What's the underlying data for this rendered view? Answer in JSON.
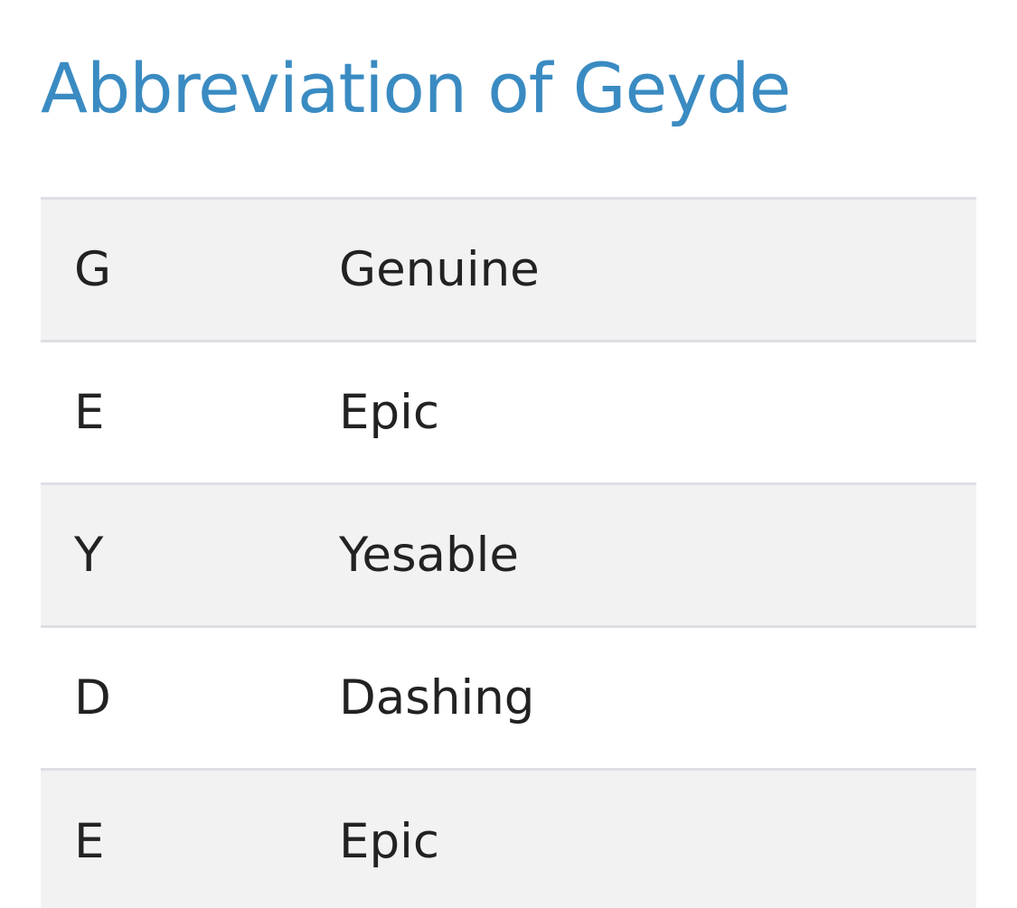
{
  "title": "Abbreviation of Geyde",
  "rows": [
    {
      "letter": "G",
      "word": "Genuine"
    },
    {
      "letter": "E",
      "word": "Epic"
    },
    {
      "letter": "Y",
      "word": "Yesable"
    },
    {
      "letter": "D",
      "word": "Dashing"
    },
    {
      "letter": "E",
      "word": "Epic"
    }
  ],
  "colors": {
    "title": "#3a8bc2",
    "row_shaded": "#f2f2f2",
    "row_plain": "#ffffff",
    "divider": "#dedfe4",
    "text": "#222222"
  }
}
